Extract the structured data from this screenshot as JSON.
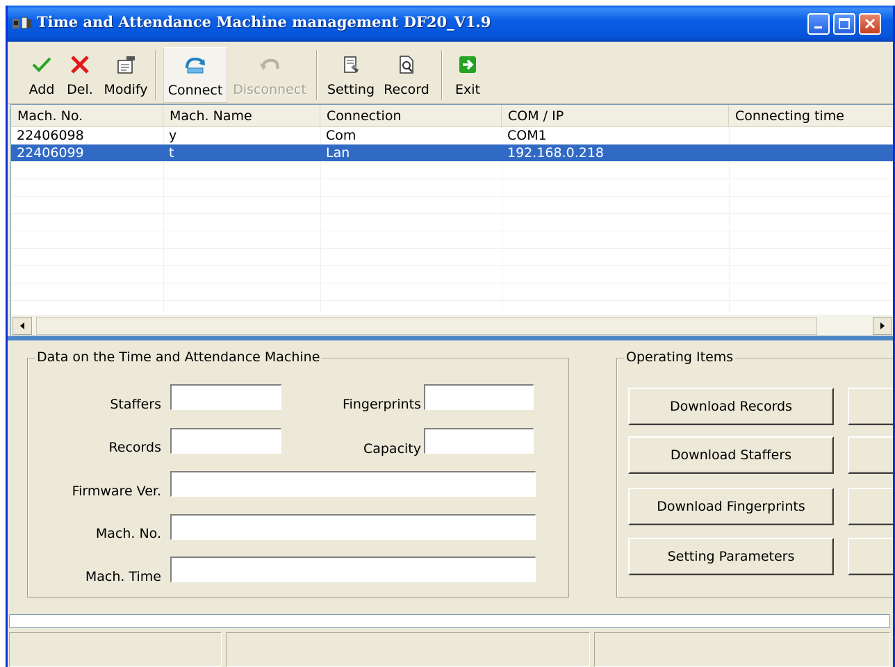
{
  "window": {
    "title": "Time and Attendance Machine management DF20_V1.9"
  },
  "toolbar": {
    "add": "Add",
    "del": "Del.",
    "modify": "Modify",
    "connect": "Connect",
    "disconnect": "Disconnect",
    "setting": "Setting",
    "record": "Record",
    "exit": "Exit"
  },
  "machine_list": {
    "columns": [
      "Mach. No.",
      "Mach. Name",
      "Connection",
      "COM / IP",
      "Connecting time"
    ],
    "rows": [
      {
        "mach_no": "22406098",
        "mach_name": "y",
        "connection": "Com",
        "com_ip": "COM1",
        "connecting_time": "",
        "selected": false
      },
      {
        "mach_no": "22406099",
        "mach_name": "t",
        "connection": "Lan",
        "com_ip": "192.168.0.218",
        "connecting_time": "",
        "selected": true
      }
    ]
  },
  "machine_data": {
    "title": "Data on the Time and Attendance Machine",
    "staffers_label": "Staffers",
    "staffers_value": "",
    "records_label": "Records",
    "records_value": "",
    "fingerprints_label": "Fingerprints",
    "fingerprints_value": "",
    "capacity_label": "Capacity",
    "capacity_value": "",
    "firmware_label": "Firmware Ver.",
    "firmware_value": "",
    "mach_no_label": "Mach. No.",
    "mach_no_value": "",
    "mach_time_label": "Mach. Time",
    "mach_time_value": ""
  },
  "operating_items": {
    "title": "Operating Items",
    "download_records": "Download Records",
    "download_staffers": "Download Staffers",
    "download_fingerprints": "Download Fingerprints",
    "setting_parameters": "Setting Parameters"
  },
  "status_bar": {
    "panel1": "",
    "panel2": "",
    "panel3": ""
  },
  "colors": {
    "titlebar": "#0a5fe6",
    "selection": "#316ac5",
    "face": "#ece9d8",
    "splitter": "#4a86c8"
  }
}
